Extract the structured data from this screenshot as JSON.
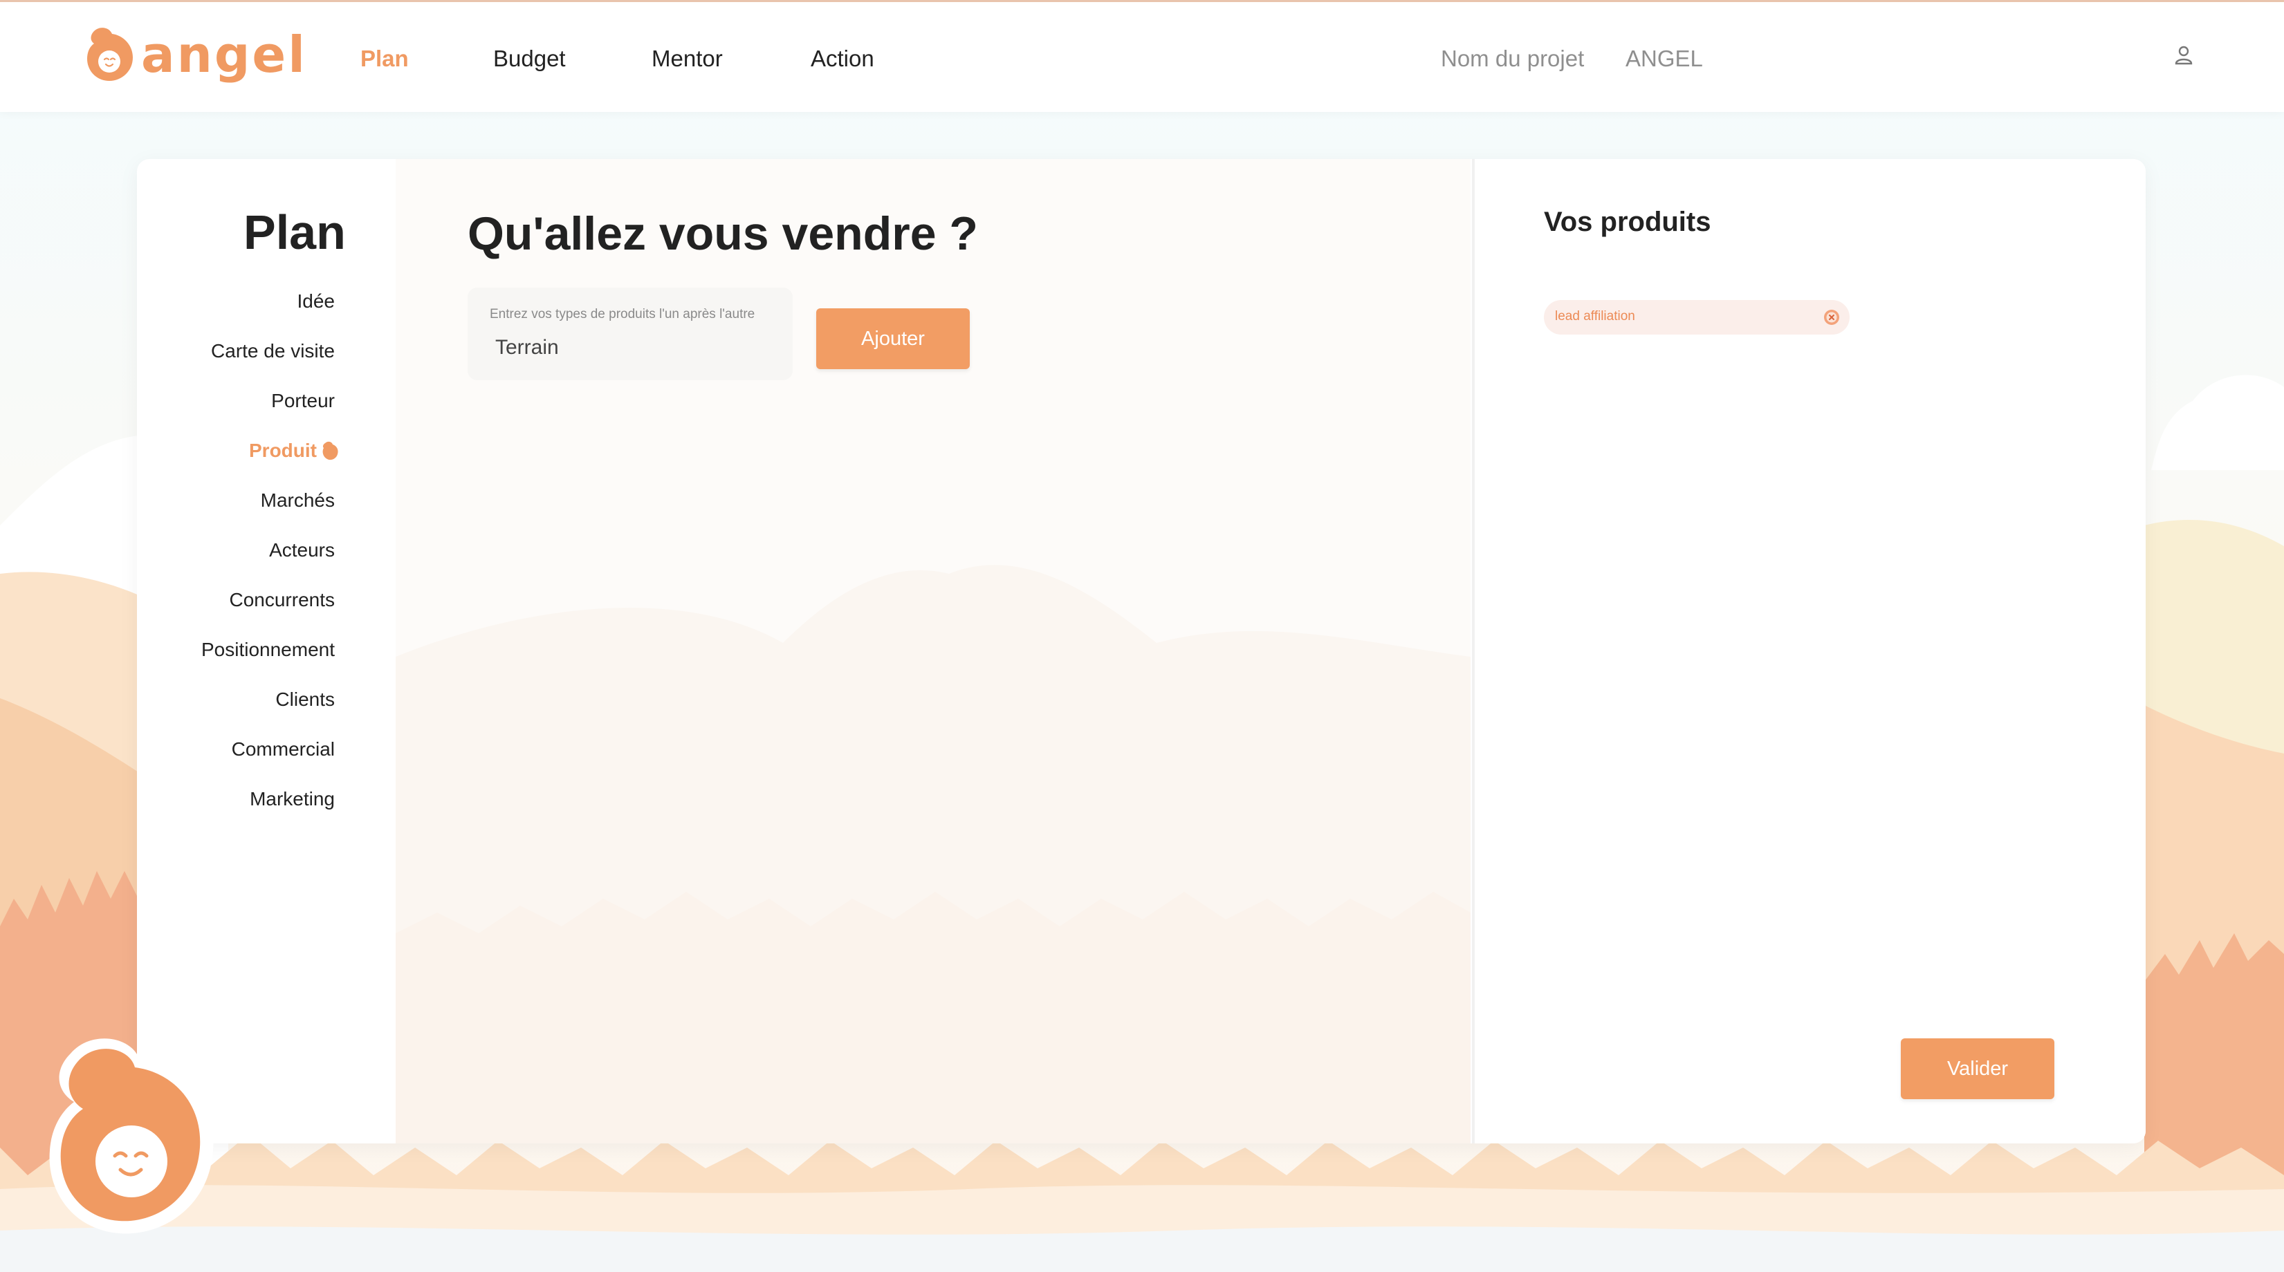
{
  "app": {
    "logo_text": "angel",
    "brand_color": "#f09a62",
    "button_color": "#f29d64"
  },
  "header": {
    "nav": [
      {
        "label": "Plan",
        "active": true
      },
      {
        "label": "Budget",
        "active": false
      },
      {
        "label": "Mentor",
        "active": false
      },
      {
        "label": "Action",
        "active": false
      }
    ],
    "project_label": "Nom du projet",
    "project_name": "ANGEL",
    "user_icon": "user-icon"
  },
  "sidebar": {
    "title": "Plan",
    "items": [
      {
        "label": "Idée",
        "active": false
      },
      {
        "label": "Carte de visite",
        "active": false
      },
      {
        "label": "Porteur",
        "active": false
      },
      {
        "label": "Produit",
        "active": true,
        "icon": "angel-drop-icon"
      },
      {
        "label": "Marchés",
        "active": false
      },
      {
        "label": "Acteurs",
        "active": false
      },
      {
        "label": "Concurrents",
        "active": false
      },
      {
        "label": "Positionnement",
        "active": false
      },
      {
        "label": "Clients",
        "active": false
      },
      {
        "label": "Commercial",
        "active": false
      },
      {
        "label": "Marketing",
        "active": false
      }
    ]
  },
  "main": {
    "question": "Qu'allez vous vendre ?",
    "input": {
      "label": "Entrez vos types de produits l'un après l'autre",
      "value": "Terrain"
    },
    "add_button": "Ajouter"
  },
  "products": {
    "title": "Vos produits",
    "items": [
      {
        "label": "lead affiliation",
        "remove_icon": "close-circle-icon"
      }
    ],
    "validate_button": "Valider"
  },
  "mascot": {
    "icon": "angel-mascot-icon"
  }
}
